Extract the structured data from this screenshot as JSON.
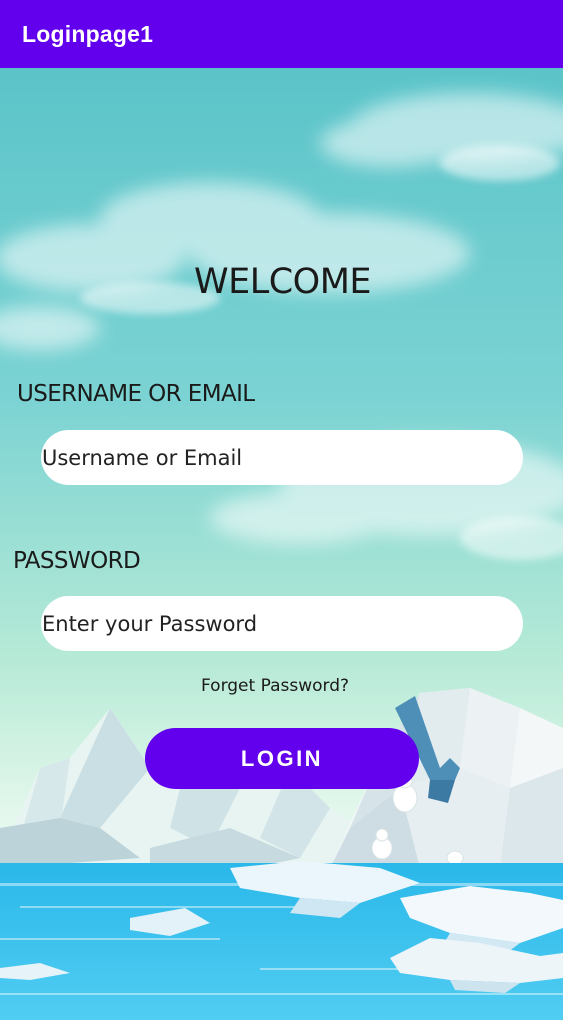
{
  "app_bar": {
    "title": "Loginpage1",
    "color": "#6200ee"
  },
  "form": {
    "welcome": "WELCOME",
    "username_label": "USERNAME OR EMAIL",
    "username_placeholder": "Username or Email",
    "password_label": "PASSWORD",
    "password_placeholder": "Enter your Password",
    "forgot_link": "Forget Password?",
    "login_button": "LOGIN",
    "button_color": "#6200ee"
  }
}
